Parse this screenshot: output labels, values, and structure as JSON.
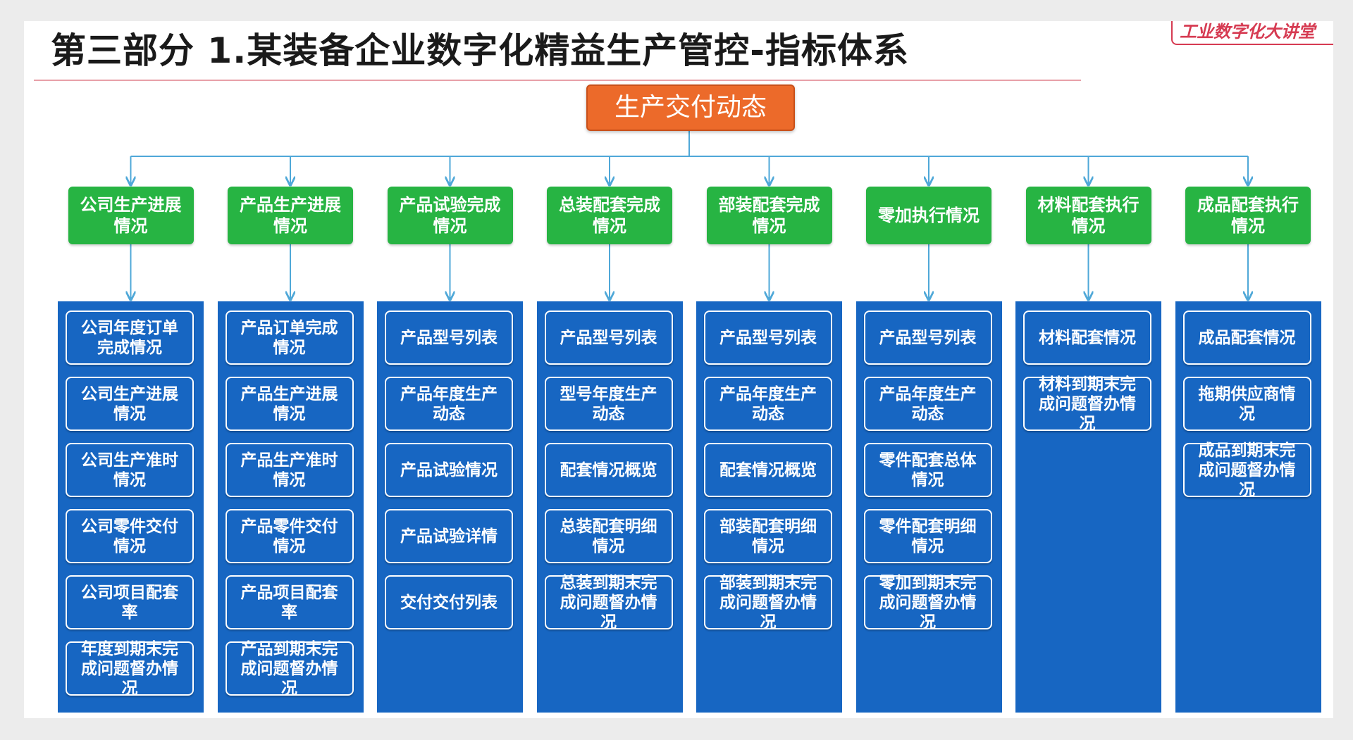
{
  "slide": {
    "title": "第三部分 1.某装备企业数字化精益生产管控-指标体系",
    "watermark": "工业数字化大讲堂"
  },
  "root": {
    "label": "生产交付动态"
  },
  "colors": {
    "root": "#ec6a2a",
    "category": "#27b443",
    "panel": "#1766c2",
    "connector": "#4fa8d8"
  },
  "categories": [
    {
      "label": "公司生产进展情况",
      "items": [
        "公司年度订单完成情况",
        "公司生产进展情况",
        "公司生产准时情况",
        "公司零件交付情况",
        "公司项目配套率",
        "年度到期末完成问题督办情况"
      ]
    },
    {
      "label": "产品生产进展情况",
      "items": [
        "产品订单完成情况",
        "产品生产进展情况",
        "产品生产准时情况",
        "产品零件交付情况",
        "产品项目配套率",
        "产品到期末完成问题督办情况"
      ]
    },
    {
      "label": "产品试验完成情况",
      "items": [
        "产品型号列表",
        "产品年度生产动态",
        "产品试验情况",
        "产品试验详情",
        "交付交付列表"
      ]
    },
    {
      "label": "总装配套完成情况",
      "items": [
        "产品型号列表",
        "型号年度生产动态",
        "配套情况概览",
        "总装配套明细情况",
        "总装到期末完成问题督办情况"
      ]
    },
    {
      "label": "部装配套完成情况",
      "items": [
        "产品型号列表",
        "产品年度生产动态",
        "配套情况概览",
        "部装配套明细情况",
        "部装到期末完成问题督办情况"
      ]
    },
    {
      "label": "零加执行情况",
      "items": [
        "产品型号列表",
        "产品年度生产动态",
        "零件配套总体情况",
        "零件配套明细情况",
        "零加到期末完成问题督办情况"
      ]
    },
    {
      "label": "材料配套执行情况",
      "items": [
        "材料配套情况",
        "材料到期末完成问题督办情况"
      ]
    },
    {
      "label": "成品配套执行情况",
      "items": [
        "成品配套情况",
        "拖期供应商情况",
        "成品到期末完成问题督办情况"
      ]
    }
  ]
}
